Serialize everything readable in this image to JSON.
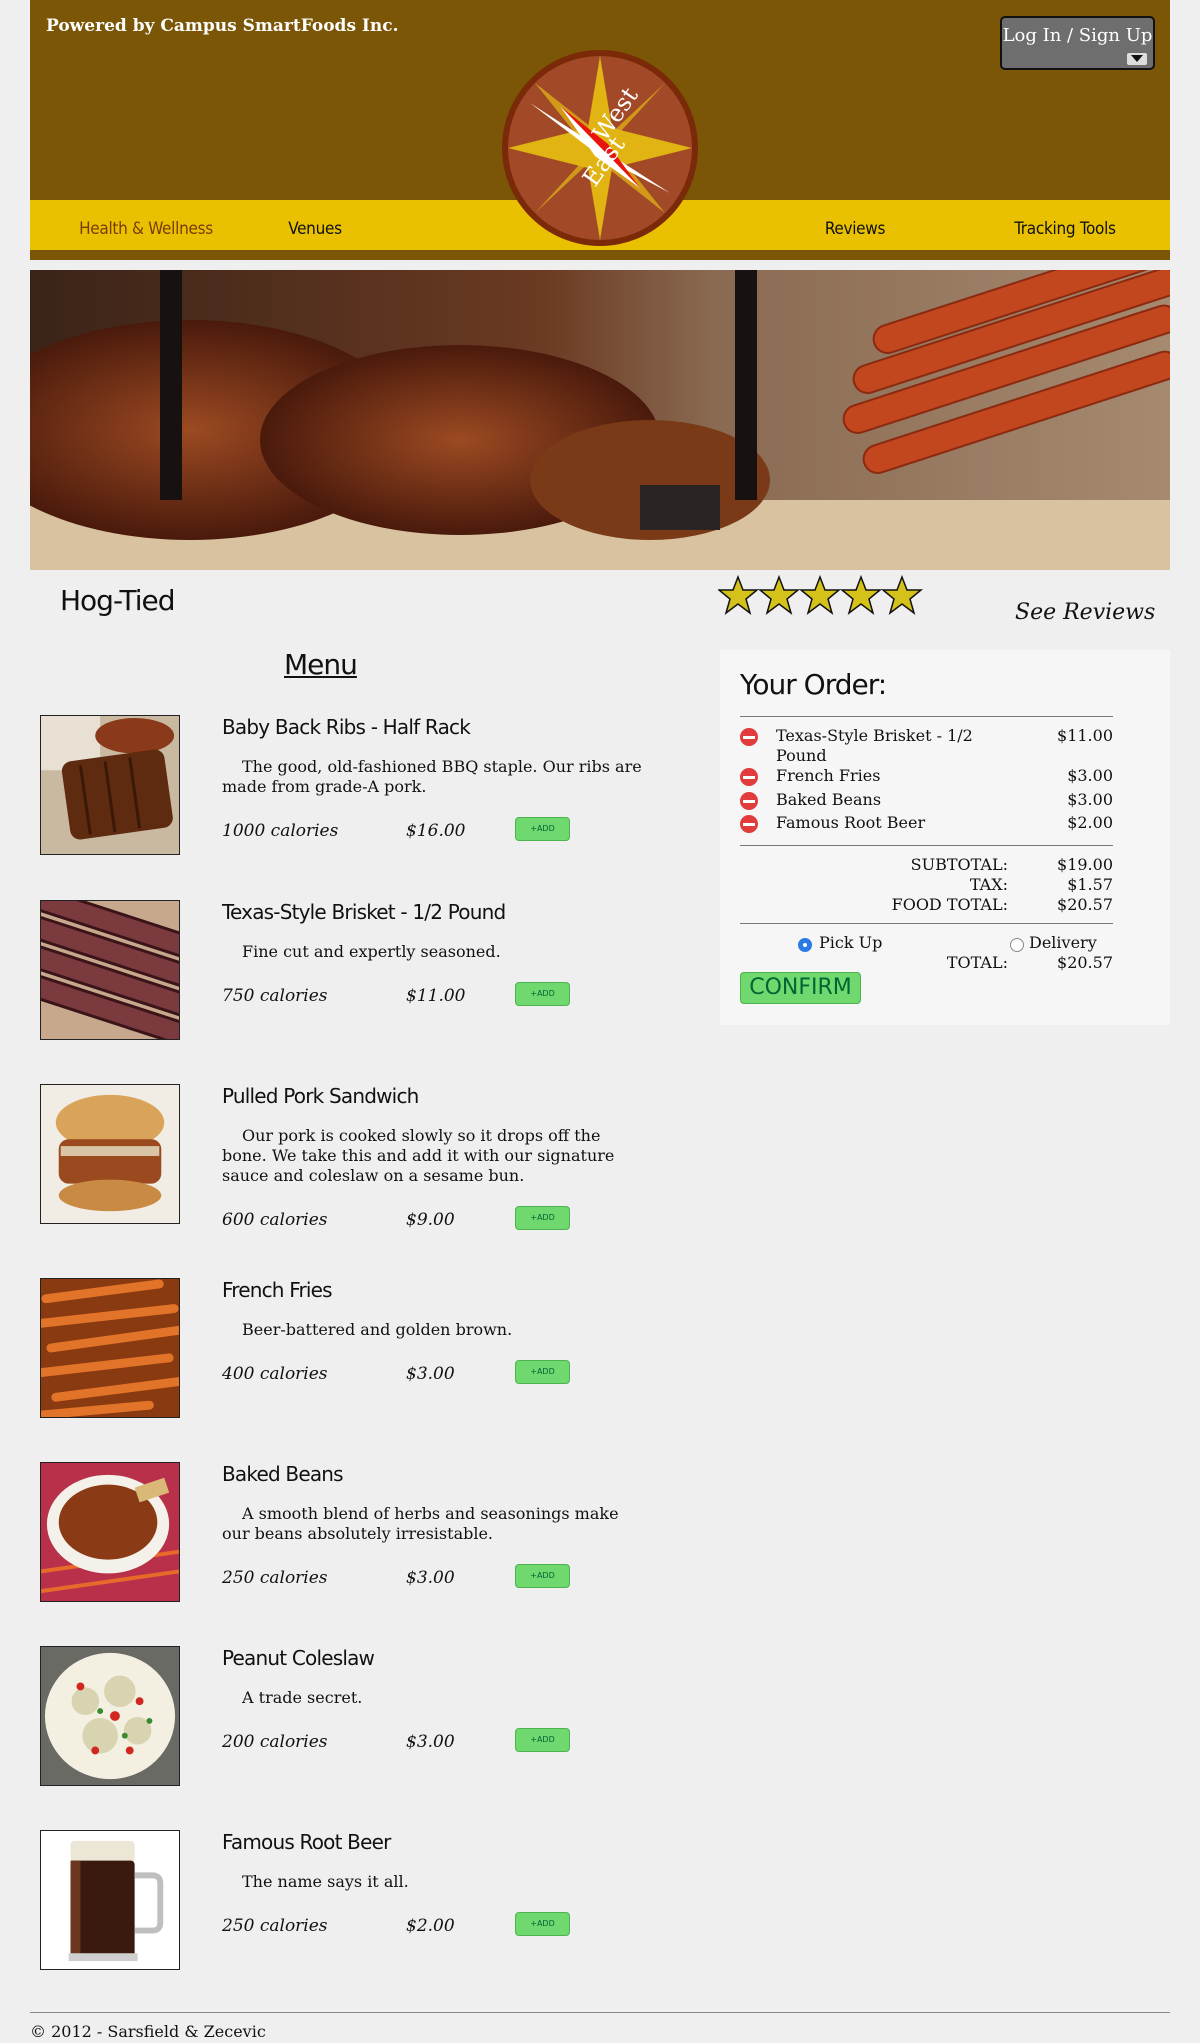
{
  "header": {
    "powered_by": "Powered by Campus SmartFoods Inc.",
    "login_label": "Log In / Sign Up",
    "logo_text_east": "East",
    "logo_text_west": "West"
  },
  "nav": {
    "items": [
      {
        "label": "Health & Wellness"
      },
      {
        "label": "Venues"
      },
      {
        "label": "Reviews"
      },
      {
        "label": "Tracking Tools"
      }
    ]
  },
  "restaurant": {
    "name": "Hog-Tied",
    "rating": 5,
    "rating_max": 5,
    "see_reviews": "See Reviews"
  },
  "menu": {
    "title": "Menu",
    "add_label": "+ADD",
    "items": [
      {
        "name": "Baby Back Ribs - Half Rack",
        "desc": "The good, old-fashioned BBQ staple. Our ribs are made from grade-A pork.",
        "calories": "1000 calories",
        "price": "$16.00"
      },
      {
        "name": "Texas-Style Brisket - 1/2 Pound",
        "desc": "Fine cut and expertly seasoned.",
        "calories": "750 calories",
        "price": "$11.00"
      },
      {
        "name": "Pulled Pork Sandwich",
        "desc": "Our pork is cooked slowly so it drops off the bone. We take this and add it with our signature sauce and coleslaw on a sesame bun.",
        "calories": "600 calories",
        "price": "$9.00"
      },
      {
        "name": "French Fries",
        "desc": "Beer-battered and golden brown.",
        "calories": "400 calories",
        "price": "$3.00"
      },
      {
        "name": "Baked Beans",
        "desc": "A smooth blend of herbs and seasonings make our beans absolutely irresistable.",
        "calories": "250 calories",
        "price": "$3.00"
      },
      {
        "name": "Peanut Coleslaw",
        "desc": "A trade secret.",
        "calories": "200 calories",
        "price": "$3.00"
      },
      {
        "name": "Famous Root Beer",
        "desc": "The name says it all.",
        "calories": "250 calories",
        "price": "$2.00"
      }
    ]
  },
  "order": {
    "title": "Your Order:",
    "items": [
      {
        "name": "Texas-Style Brisket - 1/2 Pound",
        "price": "$11.00"
      },
      {
        "name": "French Fries",
        "price": "$3.00"
      },
      {
        "name": "Baked Beans",
        "price": "$3.00"
      },
      {
        "name": "Famous Root Beer",
        "price": "$2.00"
      }
    ],
    "subtotal_label": "SUBTOTAL:",
    "subtotal": "$19.00",
    "tax_label": "TAX:",
    "tax": "$1.57",
    "food_total_label": "FOOD TOTAL:",
    "food_total": "$20.57",
    "pickup_label": "Pick Up",
    "delivery_label": "Delivery",
    "selected_option": "Pick Up",
    "total_label": "TOTAL:",
    "total": "$20.57",
    "confirm_label": "CONFIRM"
  },
  "footer": {
    "text": "© 2012 - Sarsfield & Zecevic"
  },
  "colors": {
    "brown": "#7a5606",
    "gold": "#e9c100",
    "add_green": "#6fd96f",
    "remove_red": "#e23b3b"
  }
}
